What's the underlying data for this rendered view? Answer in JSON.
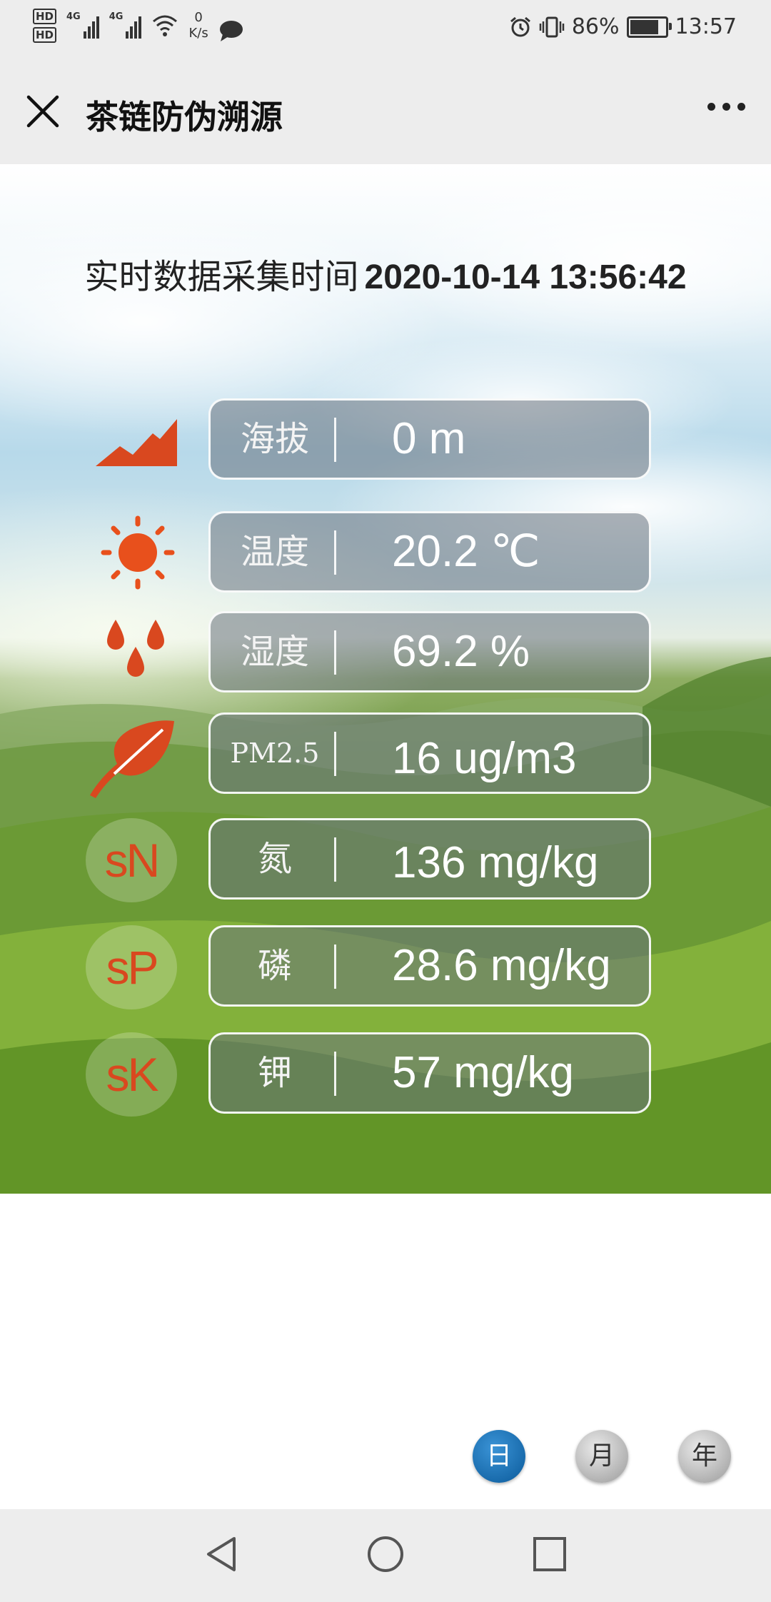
{
  "status_bar": {
    "hd1": "HD",
    "hd2": "HD",
    "net1": "4G",
    "net2": "4G",
    "speed_value": "0",
    "speed_unit": "K/s",
    "battery": "86%",
    "battery_level": 0.86,
    "time": "13:57",
    "icons": [
      "signal-icon",
      "wifi-icon",
      "message-icon",
      "alarm-icon",
      "vibrate-icon",
      "battery-icon"
    ]
  },
  "nav": {
    "title": "茶链防伪溯源"
  },
  "realtime": {
    "label": "实时数据采集时间",
    "time": "2020-10-14 13:56:42"
  },
  "metrics": [
    {
      "icon": "mountain-icon",
      "label": "海拔",
      "value": "0 m"
    },
    {
      "icon": "sun-icon",
      "label": "温度",
      "value": "20.2 ℃"
    },
    {
      "icon": "water-drops-icon",
      "label": "湿度",
      "value": "69.2 %"
    },
    {
      "icon": "leaf-icon",
      "label": "PM2.5",
      "value": "16 ug/m3"
    },
    {
      "badge": "sN",
      "label": "氮",
      "value": "136 mg/kg"
    },
    {
      "badge": "sP",
      "label": "磷",
      "value": "28.6 mg/kg"
    },
    {
      "badge": "sK",
      "label": "钾",
      "value": "57 mg/kg"
    }
  ],
  "periods": [
    {
      "label": "日",
      "active": true
    },
    {
      "label": "月",
      "active": false
    },
    {
      "label": "年",
      "active": false
    }
  ],
  "colors": {
    "accent_orange": "#d9481f",
    "active_blue": "#0b5a9a"
  }
}
